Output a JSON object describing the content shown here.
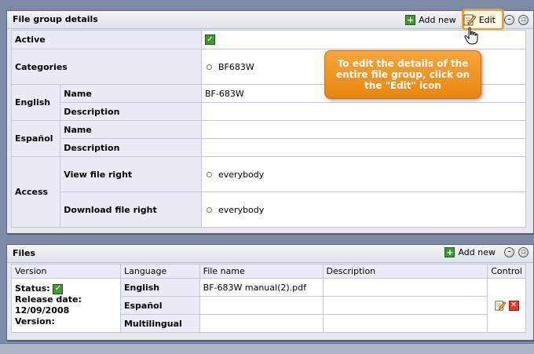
{
  "details_panel": {
    "title": "File group details",
    "add_new_label": "Add new",
    "edit_label": "Edit",
    "rows": {
      "active_label": "Active",
      "categories_label": "Categories",
      "categories_value": "BF683W",
      "english_label": "English",
      "espanol_label": "Español",
      "access_label": "Access",
      "name_label": "Name",
      "description_label": "Description",
      "english_name_value": "BF-683W",
      "view_right_label": "View file right",
      "view_right_value": "everybody",
      "download_right_label": "Download file right",
      "download_right_value": "everybody"
    }
  },
  "tooltip": {
    "text": "To edit the details of the entire file group, click on the \"Edit\" icon"
  },
  "files_panel": {
    "title": "Files",
    "add_new_label": "Add new",
    "columns": [
      "Version",
      "Language",
      "File name",
      "Description",
      "Control"
    ],
    "version_info": {
      "status_label": "Status:",
      "release_label": "Release date:",
      "release_date": "12/09/2008",
      "version_label": "Version:"
    },
    "languages": [
      {
        "name": "English",
        "file": "BF-683W manual(2).pdf"
      },
      {
        "name": "Español",
        "file": ""
      },
      {
        "name": "Multilingual",
        "file": ""
      }
    ]
  },
  "colors": {
    "accent": "#f0a028",
    "panel_bg": "#e6e8ee",
    "page_bg": "#7d8aa6"
  },
  "icons": [
    "plus-icon",
    "edit-icon",
    "minimize-icon",
    "maximize-icon",
    "check-icon",
    "hand-cursor-icon",
    "delete-icon"
  ]
}
